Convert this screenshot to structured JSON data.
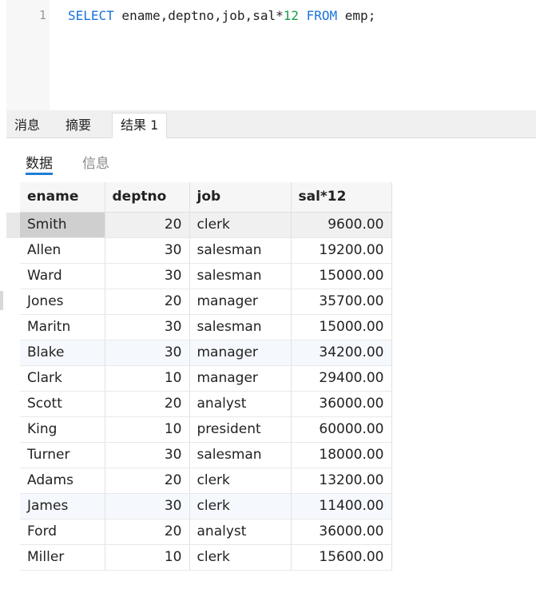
{
  "editor": {
    "line_number": "1",
    "code": {
      "kw_select": "SELECT",
      "fields": " ename,deptno,job,sal*",
      "number": "12",
      "kw_from": "FROM",
      "table": " emp;"
    }
  },
  "tabs": [
    {
      "label": "消息"
    },
    {
      "label": "摘要"
    },
    {
      "label": "结果 1",
      "active": true
    }
  ],
  "subtabs": [
    {
      "label": "数据",
      "active": true
    },
    {
      "label": "信息"
    }
  ],
  "grid": {
    "columns": [
      "ename",
      "deptno",
      "job",
      "sal*12"
    ],
    "rows": [
      [
        "Smith",
        "20",
        "clerk",
        "9600.00"
      ],
      [
        "Allen",
        "30",
        "salesman",
        "19200.00"
      ],
      [
        "Ward",
        "30",
        "salesman",
        "15000.00"
      ],
      [
        "Jones",
        "20",
        "manager",
        "35700.00"
      ],
      [
        "Maritn",
        "30",
        "salesman",
        "15000.00"
      ],
      [
        "Blake",
        "30",
        "manager",
        "34200.00"
      ],
      [
        "Clark",
        "10",
        "manager",
        "29400.00"
      ],
      [
        "Scott",
        "20",
        "analyst",
        "36000.00"
      ],
      [
        "King",
        "10",
        "president",
        "60000.00"
      ],
      [
        "Turner",
        "30",
        "salesman",
        "18000.00"
      ],
      [
        "Adams",
        "20",
        "clerk",
        "13200.00"
      ],
      [
        "James",
        "30",
        "clerk",
        "11400.00"
      ],
      [
        "Ford",
        "20",
        "analyst",
        "36000.00"
      ],
      [
        "Miller",
        "10",
        "clerk",
        "15600.00"
      ]
    ]
  },
  "colors": {
    "keyword": "#1a73d9",
    "number": "#1a9e4a",
    "accent": "#1e7fd6"
  }
}
